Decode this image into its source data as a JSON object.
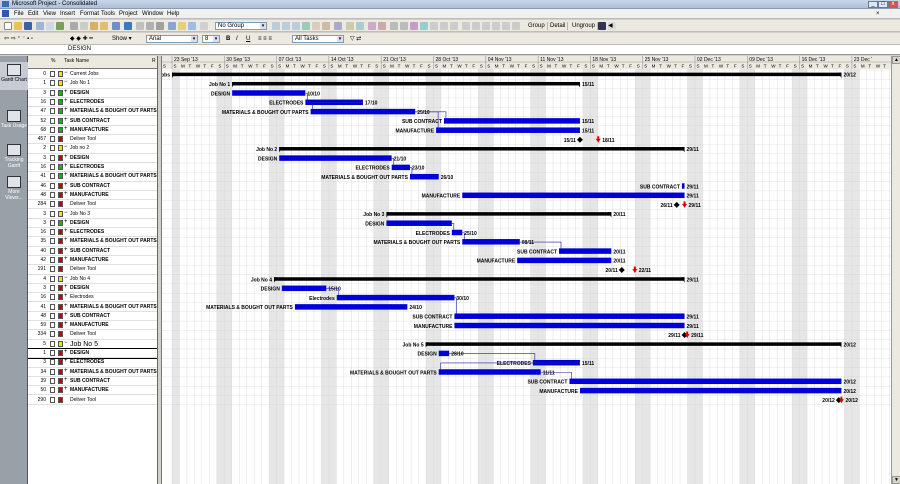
{
  "app": {
    "title": "Microsoft Project - Consolidated"
  },
  "menu": [
    "File",
    "Edit",
    "View",
    "Insert",
    "Format",
    "Tools",
    "Project",
    "Window",
    "Help"
  ],
  "toolbar": {
    "group_value": "No Group",
    "font_value": "Arial",
    "size_value": "8",
    "filter_value": "All Tasks",
    "show_label": "Show",
    "bold": "B",
    "italic": "I",
    "underline": "U",
    "group_btn": "Group",
    "detail_btn": "Detail",
    "ungroup_btn": "Ungroup"
  },
  "entry_value": "DESIGN",
  "viewbar": [
    {
      "label": "Gantt Chart",
      "icon": "gantt-chart-icon"
    },
    {
      "label": "Task Usage",
      "icon": "task-usage-icon"
    },
    {
      "label": "Tracking Gantt",
      "icon": "tracking-gantt-icon"
    },
    {
      "label": "More Views...",
      "icon": "more-views-icon"
    }
  ],
  "grid_header": {
    "indicator": "%",
    "name": "Task Name",
    "r": "R"
  },
  "weeks": [
    "23 Sep '13",
    "30 Sep '13",
    "07 Oct '13",
    "14 Oct '13",
    "21 Oct '13",
    "28 Oct '13",
    "04 Nov '13",
    "11 Nov '13",
    "18 Nov '13",
    "25 Nov '13",
    "02 Dec '13",
    "09 Dec '13",
    "16 Dec '13",
    "23 Dec '"
  ],
  "day_letters": [
    "S",
    "M",
    "T",
    "W",
    "T",
    "F",
    "S"
  ],
  "colors": {
    "bar": "#0000d8",
    "summary": "#000000",
    "milestone_red": "#e00000",
    "link": "#2020a0"
  },
  "tasks": [
    {
      "id": "0",
      "name": "Current Jobs",
      "color": "yellow",
      "plus": "−",
      "type": "summary",
      "s": 0,
      "e": 12.8,
      "label_left": "Current Jobs",
      "label_right": "20/12"
    },
    {
      "id": "1",
      "name": "Job No 1",
      "color": "yellow",
      "plus": "−",
      "type": "summary",
      "s": 1.15,
      "e": 7.8,
      "label_left": "Job No 1",
      "label_right": "15/11"
    },
    {
      "id": "3",
      "name": "DESIGN",
      "color": "green",
      "plus": "+",
      "bold": true,
      "type": "bar",
      "s": 1.15,
      "e": 2.55,
      "label_left": "DESIGN",
      "label_right": "10/10"
    },
    {
      "id": "16",
      "name": "ELECTRODES",
      "color": "green",
      "plus": "+",
      "bold": true,
      "type": "bar",
      "s": 2.55,
      "e": 3.65,
      "label_left": "ELECTRODES",
      "label_right": "17/10"
    },
    {
      "id": "47",
      "name": "MATERIALS & BOUGHT OUT PARTS",
      "color": "green",
      "plus": "+",
      "bold": true,
      "type": "bar",
      "s": 2.65,
      "e": 4.65,
      "label_left": "MATERIALS & BOUGHT OUT PARTS",
      "label_right": "25/10"
    },
    {
      "id": "52",
      "name": "SUB CONTRACT",
      "color": "green",
      "plus": "+",
      "bold": true,
      "type": "bar",
      "s": 5.2,
      "e": 7.8,
      "label_left": "SUB CONTRACT",
      "label_right": "15/11"
    },
    {
      "id": "68",
      "name": "MANUFACTURE",
      "color": "green",
      "plus": "+",
      "bold": true,
      "type": "bar",
      "s": 5.05,
      "e": 7.8,
      "label_left": "MANUFACTURE",
      "label_right": "15/11"
    },
    {
      "id": "457",
      "name": "Deliver Tool",
      "color": "red",
      "plus": "",
      "type": "milestones",
      "m1": 7.8,
      "m1_label": "15/11",
      "m2": 8.15,
      "m2_label": "18/11"
    },
    {
      "id": "2",
      "name": "Job no 2",
      "color": "yellow",
      "plus": "−",
      "type": "summary",
      "s": 2.05,
      "e": 9.8,
      "label_left": "Job No 2",
      "label_right": "29/11"
    },
    {
      "id": "3",
      "name": "DESIGN",
      "color": "red",
      "plus": "+",
      "bold": true,
      "type": "bar",
      "s": 2.05,
      "e": 4.2,
      "label_left": "DESIGN",
      "label_right": "21/10"
    },
    {
      "id": "16",
      "name": "ELECTRODES",
      "color": "green",
      "plus": "+",
      "bold": true,
      "type": "bar",
      "s": 4.2,
      "e": 4.55,
      "label_left": "ELECTRODES",
      "label_right": "23/10"
    },
    {
      "id": "41",
      "name": "MATERIALS & BOUGHT OUT PARTS",
      "color": "green",
      "plus": "+",
      "bold": true,
      "type": "bar",
      "s": 4.55,
      "e": 5.1,
      "label_left": "MATERIALS & BOUGHT OUT PARTS",
      "label_right": "26/10"
    },
    {
      "id": "46",
      "name": "SUB CONTRACT",
      "color": "red",
      "plus": "+",
      "bold": true,
      "type": "bar",
      "s": 9.75,
      "e": 9.8,
      "label_left": "SUB CONTRACT",
      "label_right": "29/11"
    },
    {
      "id": "48",
      "name": "MANUFACTURE",
      "color": "red",
      "plus": "+",
      "bold": true,
      "type": "bar",
      "s": 5.55,
      "e": 9.8,
      "label_left": "MANUFACTURE",
      "label_right": "29/11"
    },
    {
      "id": "284",
      "name": "Deliver Tool",
      "color": "red",
      "plus": "",
      "type": "milestones",
      "m1": 9.65,
      "m1_label": "26/11",
      "m2": 9.8,
      "m2_label": "29/11"
    },
    {
      "id": "3",
      "name": "Job No 3",
      "color": "yellow",
      "plus": "−",
      "type": "summary",
      "s": 4.1,
      "e": 8.4,
      "label_left": "Job No 3",
      "label_right": "20/11"
    },
    {
      "id": "3",
      "name": "DESIGN",
      "color": "green",
      "plus": "+",
      "bold": true,
      "type": "bar",
      "s": 4.1,
      "e": 5.35,
      "label_left": "DESIGN",
      "label_right": ""
    },
    {
      "id": "16",
      "name": "ELECTRODES",
      "color": "red",
      "plus": "+",
      "bold": true,
      "type": "bar",
      "s": 5.35,
      "e": 5.55,
      "label_left": "ELECTRODES",
      "label_right": "25/10"
    },
    {
      "id": "35",
      "name": "MATERIALS & BOUGHT OUT PARTS",
      "color": "red",
      "plus": "+",
      "bold": true,
      "type": "bar",
      "s": 5.55,
      "e": 6.65,
      "label_left": "MATERIALS & BOUGHT OUT PARTS",
      "label_right": "08/11"
    },
    {
      "id": "40",
      "name": "SUB CONTRACT",
      "color": "red",
      "plus": "+",
      "bold": true,
      "type": "bar",
      "s": 7.4,
      "e": 8.4,
      "label_left": "SUB CONTRACT",
      "label_right": "20/11"
    },
    {
      "id": "42",
      "name": "MANUFACTURE",
      "color": "red",
      "plus": "+",
      "bold": true,
      "type": "bar",
      "s": 6.6,
      "e": 8.4,
      "label_left": "MANUFACTURE",
      "label_right": "20/11"
    },
    {
      "id": "191",
      "name": "Deliver Tool",
      "color": "red",
      "plus": "",
      "type": "milestones",
      "m1": 8.6,
      "m1_label": "20/11",
      "m2": 8.85,
      "m2_label": "22/11"
    },
    {
      "id": "4",
      "name": "Job No 4",
      "color": "yellow",
      "plus": "−",
      "type": "summary",
      "s": 1.95,
      "e": 9.8,
      "label_left": "Job No 4",
      "label_right": "29/11"
    },
    {
      "id": "3",
      "name": "DESIGN",
      "color": "red",
      "plus": "+",
      "bold": true,
      "type": "bar",
      "s": 2.1,
      "e": 2.95,
      "label_left": "DESIGN",
      "label_right": "15/10"
    },
    {
      "id": "16",
      "name": "Electrodes",
      "color": "red",
      "plus": "+",
      "bold": false,
      "type": "bar",
      "s": 3.15,
      "e": 5.4,
      "label_left": "Electrodes",
      "label_right": "30/10"
    },
    {
      "id": "41",
      "name": "MATERIALS & BOUGHT OUT PARTS",
      "color": "red",
      "plus": "+",
      "bold": true,
      "type": "bar",
      "s": 2.35,
      "e": 4.5,
      "label_left": "MATERIALS & BOUGHT OUT PARTS",
      "label_right": "24/10"
    },
    {
      "id": "48",
      "name": "SUB CONTRACT",
      "color": "red",
      "plus": "+",
      "bold": true,
      "type": "bar",
      "s": 5.4,
      "e": 9.8,
      "label_left": "SUB CONTRACT",
      "label_right": "29/11"
    },
    {
      "id": "59",
      "name": "MANUFACTURE",
      "color": "red",
      "plus": "+",
      "bold": true,
      "type": "bar",
      "s": 5.4,
      "e": 9.8,
      "label_left": "MANUFACTURE",
      "label_right": "29/11"
    },
    {
      "id": "334",
      "name": "Deliver Tool",
      "color": "red",
      "plus": "",
      "type": "milestones",
      "m1": 9.8,
      "m1_label": "29/11",
      "m2": 9.85,
      "m2_label": "29/11"
    },
    {
      "id": "5",
      "name": "Job No 5",
      "color": "yellow",
      "plus": "−",
      "type": "summary",
      "big": true,
      "s": 4.85,
      "e": 12.8,
      "label_left": "Job No 5",
      "label_right": "20/12"
    },
    {
      "id": "1",
      "name": "DESIGN",
      "color": "red",
      "plus": "+",
      "bold": true,
      "sel": true,
      "type": "bar",
      "s": 5.1,
      "e": 5.3,
      "label_left": "DESIGN",
      "label_right": "28/10"
    },
    {
      "id": "3",
      "name": "ELECTRODES",
      "color": "red",
      "plus": "+",
      "bold": true,
      "type": "bar",
      "s": 6.9,
      "e": 7.8,
      "label_left": "ELECTRODES",
      "label_right": "15/11"
    },
    {
      "id": "34",
      "name": "MATERIALS & BOUGHT OUT PARTS",
      "color": "red",
      "plus": "+",
      "bold": true,
      "type": "bar",
      "s": 5.1,
      "e": 7.05,
      "label_left": "MATERIALS & BOUGHT OUT PARTS",
      "label_right": "11/11"
    },
    {
      "id": "39",
      "name": "SUB CONTRACT",
      "color": "red",
      "plus": "+",
      "bold": true,
      "type": "bar",
      "s": 7.6,
      "e": 12.8,
      "label_left": "SUB CONTRACT",
      "label_right": "20/12"
    },
    {
      "id": "50",
      "name": "MANUFACTURE",
      "color": "red",
      "plus": "+",
      "bold": true,
      "type": "bar",
      "s": 7.8,
      "e": 12.8,
      "label_left": "MANUFACTURE",
      "label_right": "20/12"
    },
    {
      "id": "290",
      "name": "Deliver Tool",
      "color": "red",
      "plus": "",
      "type": "milestones",
      "m1": 12.75,
      "m1_label": "20/12",
      "m2": 12.8,
      "m2_label": "20/12"
    }
  ]
}
